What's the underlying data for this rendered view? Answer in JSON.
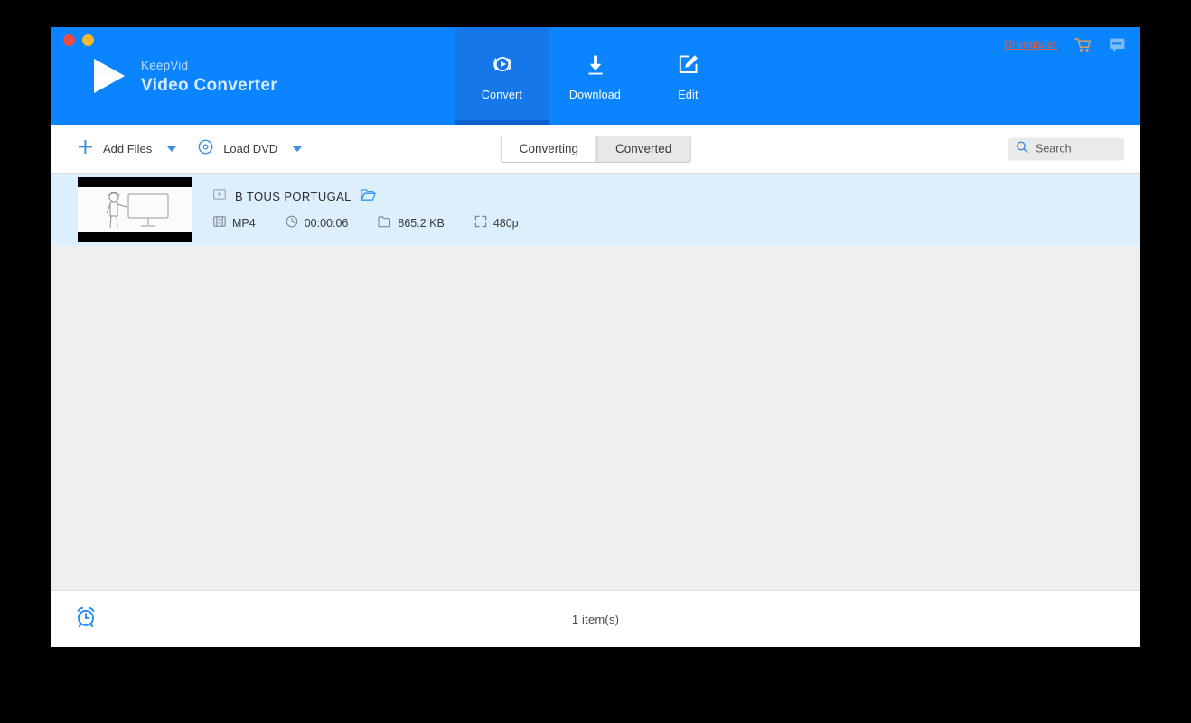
{
  "window": {
    "traffic_lights": [
      "close",
      "minimize"
    ],
    "colors": {
      "header_blue": "#0a84ff",
      "active_tab_blue": "#1577e8",
      "active_tab_underline": "#0a5fd1",
      "row_selected": "#ddeefc",
      "list_background": "#efefef",
      "unregister_link": "#e0603c"
    }
  },
  "brand": {
    "sub": "KeepVid",
    "title": "Video Converter",
    "logo_icon": "play-triangle-logo"
  },
  "nav": {
    "tabs": [
      {
        "label": "Convert",
        "icon": "convert-circular-play-icon",
        "active": true
      },
      {
        "label": "Download",
        "icon": "download-arrow-icon",
        "active": false
      },
      {
        "label": "Edit",
        "icon": "edit-pencil-square-icon",
        "active": false
      }
    ]
  },
  "header_right": {
    "unregister_label": "Unregister",
    "cart_icon": "shopping-cart-icon",
    "feedback_icon": "feedback-message-icon"
  },
  "toolbar": {
    "add_files_label": "Add Files",
    "add_files_icon": "plus-icon",
    "load_dvd_label": "Load DVD",
    "load_dvd_icon": "disc-icon",
    "caret_icon": "chevron-down-icon"
  },
  "segmented": {
    "options": [
      {
        "label": "Converting",
        "active": true
      },
      {
        "label": "Converted",
        "active": false
      }
    ]
  },
  "search": {
    "placeholder": "Search",
    "icon": "search-icon"
  },
  "files": [
    {
      "title": "B TOUS PORTUGAL",
      "title_icon": "video-play-box-icon",
      "folder_icon": "open-folder-icon",
      "thumbnail": "whiteboard-presenter-sketch",
      "meta": [
        {
          "icon": "film-strip-icon",
          "text": "MP4"
        },
        {
          "icon": "clock-icon",
          "text": "00:00:06"
        },
        {
          "icon": "folder-icon",
          "text": "865.2 KB"
        },
        {
          "icon": "resolution-expand-icon",
          "text": "480p"
        }
      ]
    }
  ],
  "footer": {
    "clock_icon": "alarm-clock-icon",
    "count_label": "1 item(s)"
  }
}
